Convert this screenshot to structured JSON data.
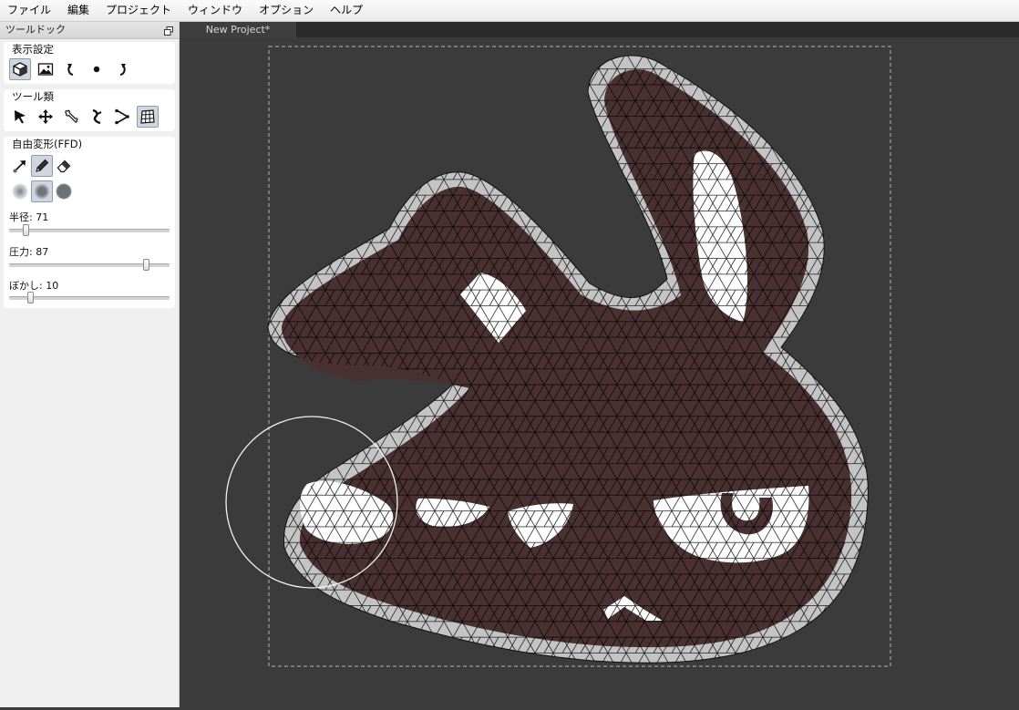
{
  "menu": [
    "ファイル",
    "編集",
    "プロジェクト",
    "ウィンドウ",
    "オプション",
    "ヘルプ"
  ],
  "dock": {
    "title": "ツールドック",
    "display_settings": {
      "title": "表示設定",
      "tools": [
        "mesh-view-icon",
        "image-view-icon",
        "rotate-left-icon",
        "point-icon",
        "rotate-right-icon"
      ],
      "active_index": 0
    },
    "tools": {
      "title": "ツール類",
      "tools": [
        "select-arrow-icon",
        "move-icon",
        "bone-icon",
        "bend-icon",
        "vertex-path-icon",
        "mesh-grid-icon"
      ],
      "active_index": 5
    },
    "ffd": {
      "title": "自由変形(FFD)",
      "modes": [
        "pull-brush-icon",
        "pencil-icon",
        "eraser-icon"
      ],
      "active_mode": 1,
      "falloffs": [
        "soft-brush-icon",
        "medium-brush-icon",
        "hard-brush-icon"
      ],
      "active_falloff": 1,
      "radius": {
        "label": "半径:",
        "value": "71",
        "fraction": 0.09
      },
      "pressure": {
        "label": "圧力:",
        "value": "87",
        "fraction": 0.87
      },
      "blur": {
        "label": "ぼかし:",
        "value": "10",
        "fraction": 0.12
      }
    }
  },
  "document": {
    "tab_title": "New Project*"
  },
  "colors": {
    "canvas_bg": "#3b3b3b",
    "body_fill": "#4a3131",
    "outline_fill": "#c4c4c4",
    "highlight": "#ffffff",
    "mesh_line": "#000000",
    "brush_cursor": "#ffffff"
  }
}
